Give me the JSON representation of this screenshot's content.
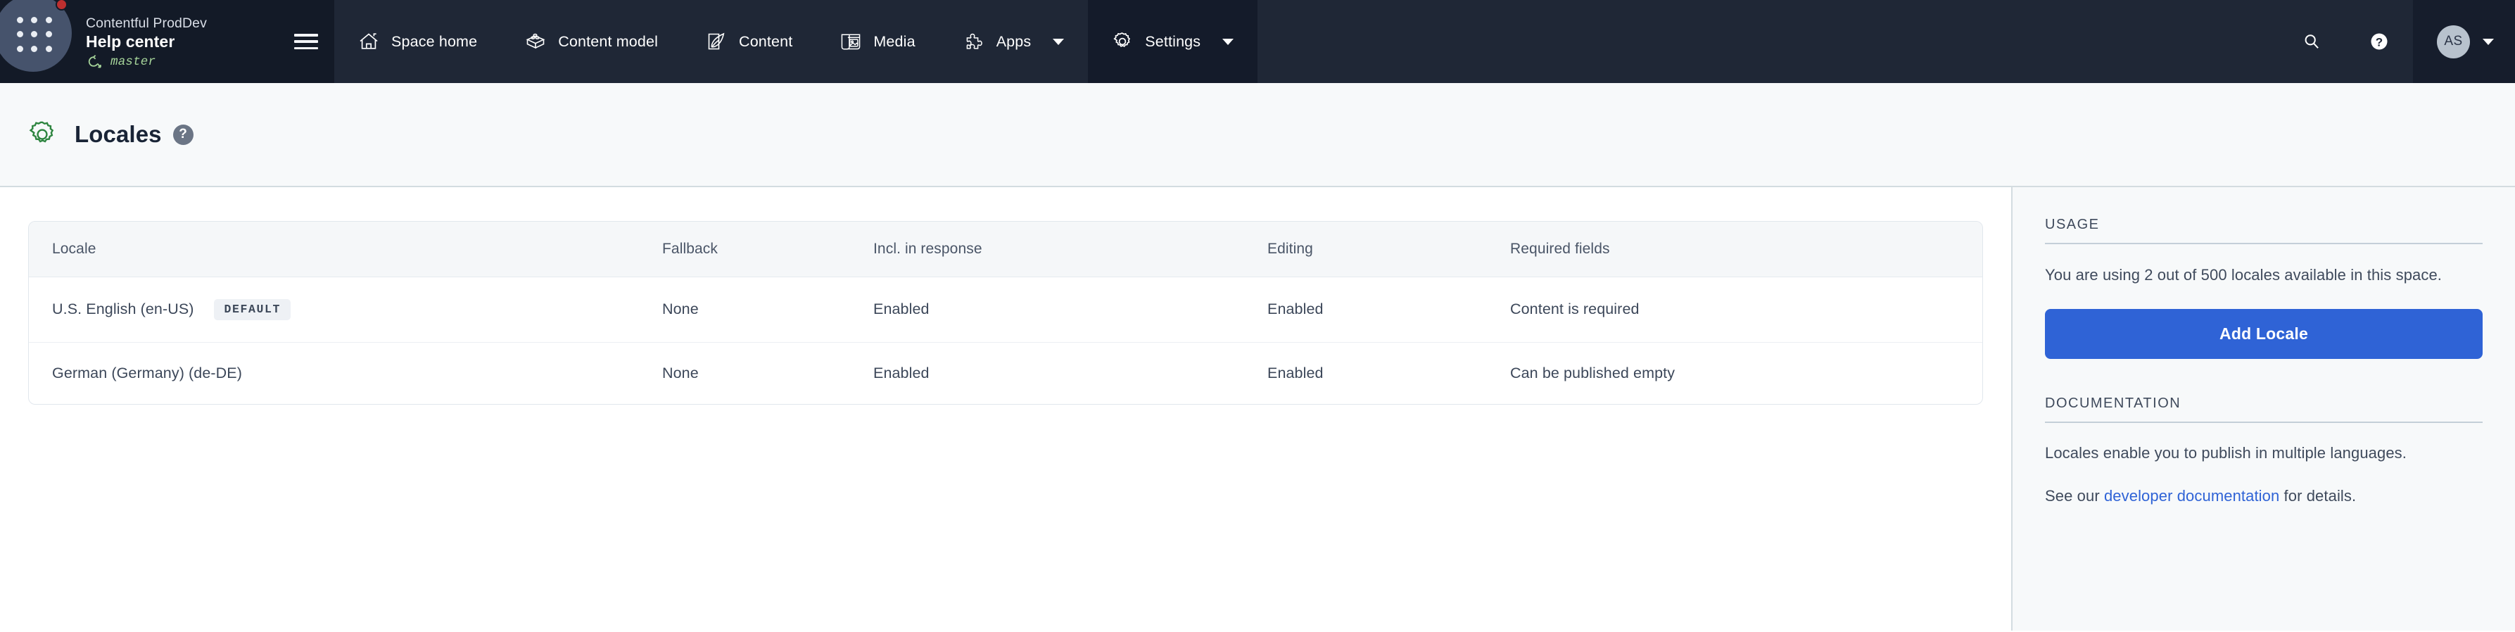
{
  "topnav": {
    "space": {
      "organization": "Contentful ProdDev",
      "name": "Help center",
      "environment": "master",
      "logo_icon": "grid-dots-icon",
      "status_badge_color": "#bd2f2f",
      "env_icon": "environment-arrow-icon",
      "menu_icon": "hamburger-menu-icon"
    },
    "items": [
      {
        "label": "Space home",
        "icon": "home-icon",
        "active": false,
        "has_caret": false
      },
      {
        "label": "Content model",
        "icon": "blocks-icon",
        "active": false,
        "has_caret": false
      },
      {
        "label": "Content",
        "icon": "quill-square-icon",
        "active": false,
        "has_caret": false
      },
      {
        "label": "Media",
        "icon": "image-frame-icon",
        "active": false,
        "has_caret": false
      },
      {
        "label": "Apps",
        "icon": "puzzle-piece-icon",
        "active": false,
        "has_caret": true
      },
      {
        "label": "Settings",
        "icon": "gear-icon",
        "active": true,
        "has_caret": true
      }
    ],
    "actions": {
      "search_icon": "search-icon",
      "help_icon": "question-circle-icon"
    },
    "user": {
      "initials": "AS",
      "caret_icon": "chevron-down-icon"
    }
  },
  "page": {
    "icon": "gear-icon",
    "title": "Locales",
    "help_icon": "question-mark-icon",
    "help_glyph": "?"
  },
  "table": {
    "columns": [
      "Locale",
      "Fallback",
      "Incl. in response",
      "Editing",
      "Required fields"
    ],
    "rows": [
      {
        "locale": "U.S. English (en-US)",
        "badge": "DEFAULT",
        "fallback": "None",
        "incl_in_response": "Enabled",
        "editing": "Enabled",
        "required_fields": "Content is required"
      },
      {
        "locale": "German (Germany) (de-DE)",
        "badge": "",
        "fallback": "None",
        "incl_in_response": "Enabled",
        "editing": "Enabled",
        "required_fields": "Can be published empty"
      }
    ]
  },
  "sidebar": {
    "usage": {
      "heading": "USAGE",
      "text": "You are using 2 out of 500 locales available in this space.",
      "used": 2,
      "limit": 500,
      "button_label": "Add Locale",
      "button_color": "#2f63d6"
    },
    "documentation": {
      "heading": "DOCUMENTATION",
      "text": "Locales enable you to publish in multiple languages.",
      "see_our_prefix": "See our ",
      "link_label": "developer documentation",
      "see_our_suffix": " for details.",
      "link_color": "#2f63d6"
    }
  }
}
